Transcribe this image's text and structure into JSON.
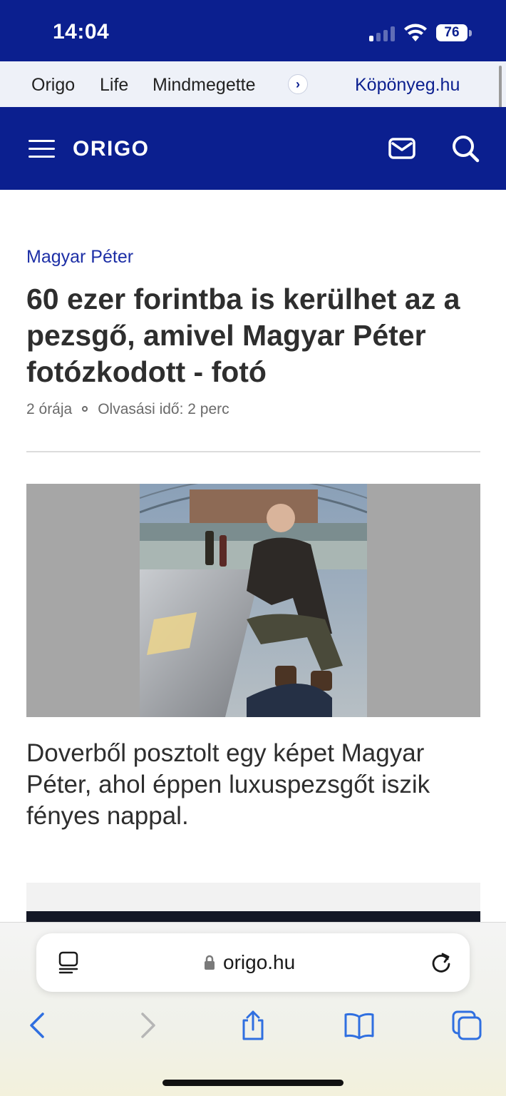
{
  "status_bar": {
    "time": "14:04",
    "battery": "76",
    "colors": {
      "background": "#0b1f8f"
    }
  },
  "sites_nav": {
    "items": [
      "Origo",
      "Life",
      "Mindmegette"
    ],
    "more_icon": "chevron-right-icon",
    "weather_link": "Köpönyeg.hu"
  },
  "header": {
    "logo": "ORIGO",
    "menu_icon": "hamburger-menu-icon",
    "mail_icon": "mail-icon",
    "search_icon": "search-icon",
    "colors": {
      "brand": "#0b1f8f"
    }
  },
  "article": {
    "category": "Magyar Péter",
    "headline": "60 ezer forintba is kerülhet az a pezsgő, amivel Magyar Péter fotózkodott - fotó",
    "published": "2 órája",
    "reading_time": "Olvasási idő: 2 perc",
    "lead": "Doverből posztolt egy képet Magyar Péter, ahol éppen luxuspezsgőt iszik fényes nappal."
  },
  "browser": {
    "url": "origo.hu",
    "toolbar_icons": [
      "back-icon",
      "forward-icon",
      "share-icon",
      "bookmarks-icon",
      "tabs-icon"
    ]
  }
}
